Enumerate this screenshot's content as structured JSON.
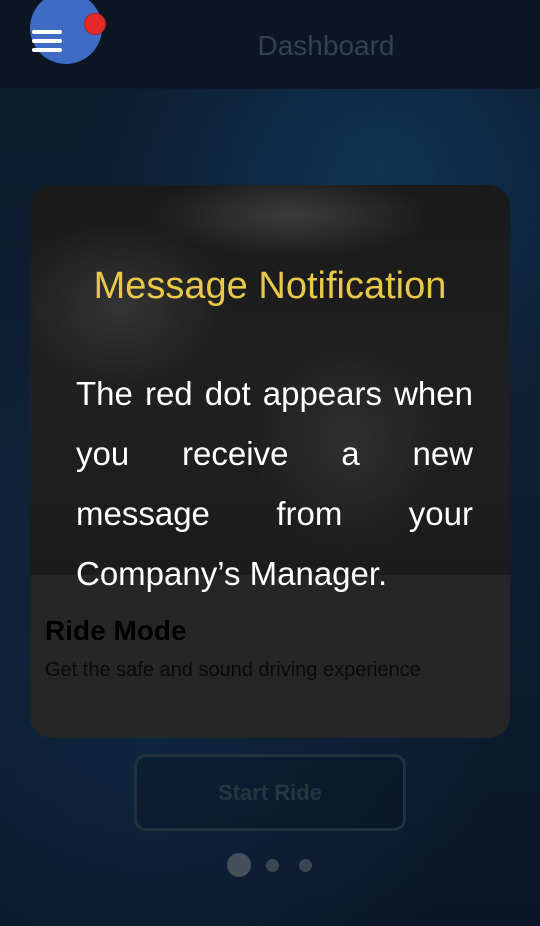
{
  "header": {
    "title": "Dashboard",
    "menu_icon": "hamburger-menu-icon",
    "notification_indicator": "red-dot"
  },
  "card": {
    "title": "Ride Mode",
    "subtitle": "Get the safe and sound driving experience"
  },
  "overlay": {
    "title": "Message Notification",
    "text": "The red dot appears when you receive a new message from your Company’s Manager."
  },
  "actions": {
    "start_label": "Start Ride"
  },
  "pager": {
    "count": 3,
    "active_index": 0
  },
  "colors": {
    "accent_yellow": "#e9c94a",
    "menu_button": "#3e6bc4",
    "badge_red": "#e52a2a"
  }
}
